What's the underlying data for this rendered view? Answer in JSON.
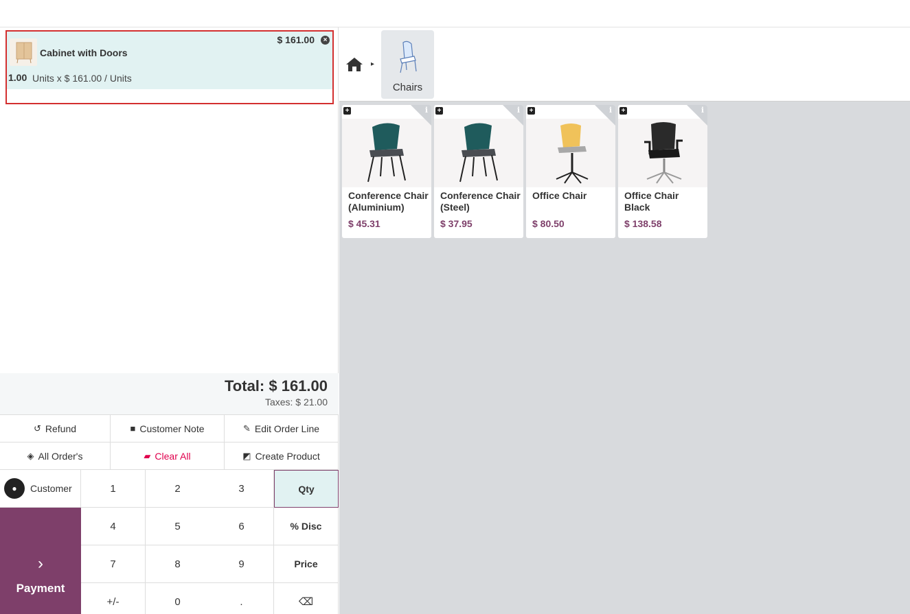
{
  "order": {
    "line": {
      "name": "Cabinet with Doors",
      "price": "$ 161.00",
      "qty": "1.00",
      "detail": "Units x $ 161.00 / Units"
    },
    "total": "Total: $ 161.00",
    "taxes": "Taxes: $ 21.00"
  },
  "actions": {
    "refund": "Refund",
    "customer_note": "Customer Note",
    "edit_order_line": "Edit Order Line",
    "all_orders": "All Order's",
    "clear_all": "Clear All",
    "create_product": "Create Product"
  },
  "numpad": {
    "customer": "Customer",
    "payment": "Payment",
    "keys": [
      "1",
      "2",
      "3",
      "Qty",
      "4",
      "5",
      "6",
      "% Disc",
      "7",
      "8",
      "9",
      "Price",
      "+/-",
      "0",
      ".",
      "⌫"
    ],
    "active_mode": "Qty"
  },
  "breadcrumb": {
    "category": "Chairs"
  },
  "products": [
    {
      "name": "Conference Chair (Aluminium)",
      "price": "$ 45.31"
    },
    {
      "name": "Conference Chair (Steel)",
      "price": "$ 37.95"
    },
    {
      "name": "Office Chair",
      "price": "$ 80.50"
    },
    {
      "name": "Office Chair Black",
      "price": "$ 138.58"
    }
  ],
  "colors": {
    "accent": "#7e3f6a",
    "selected_line": "#e1f2f2",
    "highlight_border": "#d32f2f",
    "danger": "#e0004d"
  }
}
